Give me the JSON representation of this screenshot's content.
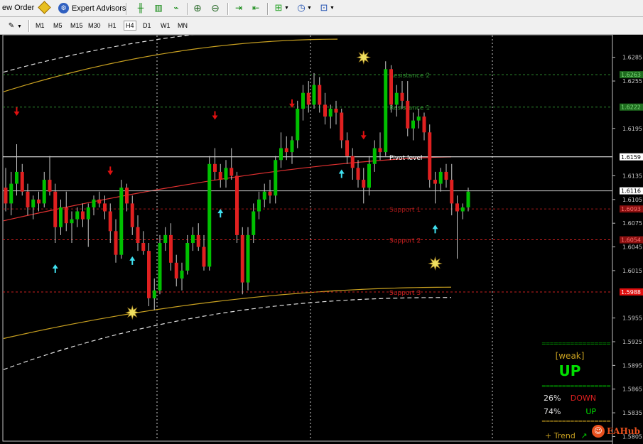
{
  "toolbar": {
    "new_order": "ew Order",
    "expert_advisors": "Expert Advisors"
  },
  "timeframes": [
    "M1",
    "M5",
    "M15",
    "M30",
    "H1",
    "H4",
    "D1",
    "W1",
    "MN"
  ],
  "selected_timeframe": "H4",
  "price_scale": [
    {
      "price": 1.6285,
      "text": "1.6285"
    },
    {
      "price": 1.6255,
      "text": "1.6255"
    },
    {
      "price": 1.6195,
      "text": "1.6195"
    },
    {
      "price": 1.6135,
      "text": "1.6135"
    },
    {
      "price": 1.6105,
      "text": "1.6105"
    },
    {
      "price": 1.6075,
      "text": "1.6075"
    },
    {
      "price": 1.6045,
      "text": "1.6045"
    },
    {
      "price": 1.6015,
      "text": "1.6015"
    },
    {
      "price": 1.5955,
      "text": "1.5955"
    },
    {
      "price": 1.5925,
      "text": "1.5925"
    },
    {
      "price": 1.5895,
      "text": "1.5895"
    },
    {
      "price": 1.5865,
      "text": "1.5865"
    },
    {
      "price": 1.5835,
      "text": "1.5835"
    },
    {
      "price": 1.5805,
      "text": "1.5805"
    }
  ],
  "price_tags": [
    {
      "price": 1.6263,
      "text": "1.6263",
      "bg": "#1f6e1f",
      "fg": "#7ddc7d"
    },
    {
      "price": 1.6222,
      "text": "1.6222",
      "bg": "#1f6e1f",
      "fg": "#7ddc7d"
    },
    {
      "price": 1.6159,
      "text": "1.6159",
      "bg": "#ffffff",
      "fg": "#000000"
    },
    {
      "price": 1.6116,
      "text": "1.6116",
      "bg": "#ffffff",
      "fg": "#000000"
    },
    {
      "price": 1.6093,
      "text": "1.6093",
      "bg": "#8a1010",
      "fg": "#ff7070"
    },
    {
      "price": 1.6054,
      "text": "1.6054",
      "bg": "#8a1010",
      "fg": "#ff7070"
    },
    {
      "price": 1.5988,
      "text": "1.5988",
      "bg": "#e01010",
      "fg": "#ffffff"
    }
  ],
  "levels": [
    {
      "price": 1.6263,
      "label": "Resistance 2",
      "color": "#2e8b2e",
      "style": "dash"
    },
    {
      "price": 1.6222,
      "label": "Resistance 1",
      "color": "#2e8b2e",
      "style": "dash"
    },
    {
      "price": 1.6159,
      "label": "Pivot level",
      "color": "#ffffff",
      "style": "solid"
    },
    {
      "price": 1.6116,
      "label": "",
      "color": "#c8c8c8",
      "style": "solid"
    },
    {
      "price": 1.6093,
      "label": "Support 1",
      "color": "#a01818",
      "style": "dash"
    },
    {
      "price": 1.6054,
      "label": "Support 2",
      "color": "#c82020",
      "style": "dash"
    },
    {
      "price": 1.5988,
      "label": "Support 3",
      "color": "#c82020",
      "style": "dash"
    }
  ],
  "candles": [
    {
      "o": 1.612,
      "h": 1.6145,
      "l": 1.609,
      "c": 1.61
    },
    {
      "o": 1.61,
      "h": 1.614,
      "l": 1.6085,
      "c": 1.6125
    },
    {
      "o": 1.6125,
      "h": 1.6175,
      "l": 1.611,
      "c": 1.614
    },
    {
      "o": 1.614,
      "h": 1.615,
      "l": 1.611,
      "c": 1.6115
    },
    {
      "o": 1.6115,
      "h": 1.6125,
      "l": 1.6085,
      "c": 1.6095
    },
    {
      "o": 1.6095,
      "h": 1.611,
      "l": 1.608,
      "c": 1.6105
    },
    {
      "o": 1.6105,
      "h": 1.6115,
      "l": 1.609,
      "c": 1.61
    },
    {
      "o": 1.61,
      "h": 1.614,
      "l": 1.6095,
      "c": 1.613
    },
    {
      "o": 1.613,
      "h": 1.616,
      "l": 1.611,
      "c": 1.6115
    },
    {
      "o": 1.6115,
      "h": 1.6125,
      "l": 1.605,
      "c": 1.607
    },
    {
      "o": 1.607,
      "h": 1.6105,
      "l": 1.606,
      "c": 1.6095
    },
    {
      "o": 1.6095,
      "h": 1.6115,
      "l": 1.6065,
      "c": 1.6075
    },
    {
      "o": 1.6075,
      "h": 1.609,
      "l": 1.605,
      "c": 1.608
    },
    {
      "o": 1.608,
      "h": 1.6095,
      "l": 1.607,
      "c": 1.609
    },
    {
      "o": 1.609,
      "h": 1.61,
      "l": 1.607,
      "c": 1.608
    },
    {
      "o": 1.608,
      "h": 1.61,
      "l": 1.6045,
      "c": 1.6095
    },
    {
      "o": 1.6095,
      "h": 1.611,
      "l": 1.6085,
      "c": 1.6105
    },
    {
      "o": 1.6105,
      "h": 1.6115,
      "l": 1.6095,
      "c": 1.61
    },
    {
      "o": 1.61,
      "h": 1.611,
      "l": 1.608,
      "c": 1.609
    },
    {
      "o": 1.609,
      "h": 1.61,
      "l": 1.605,
      "c": 1.6065
    },
    {
      "o": 1.6065,
      "h": 1.608,
      "l": 1.6025,
      "c": 1.6035
    },
    {
      "o": 1.6035,
      "h": 1.613,
      "l": 1.603,
      "c": 1.612
    },
    {
      "o": 1.612,
      "h": 1.6125,
      "l": 1.609,
      "c": 1.61
    },
    {
      "o": 1.61,
      "h": 1.611,
      "l": 1.606,
      "c": 1.607
    },
    {
      "o": 1.607,
      "h": 1.6085,
      "l": 1.604,
      "c": 1.605
    },
    {
      "o": 1.605,
      "h": 1.6065,
      "l": 1.6035,
      "c": 1.604
    },
    {
      "o": 1.604,
      "h": 1.605,
      "l": 1.597,
      "c": 1.598
    },
    {
      "o": 1.598,
      "h": 1.6005,
      "l": 1.5965,
      "c": 1.599
    },
    {
      "o": 1.599,
      "h": 1.606,
      "l": 1.5985,
      "c": 1.605
    },
    {
      "o": 1.605,
      "h": 1.607,
      "l": 1.604,
      "c": 1.606
    },
    {
      "o": 1.606,
      "h": 1.6075,
      "l": 1.6015,
      "c": 1.6025
    },
    {
      "o": 1.6025,
      "h": 1.6035,
      "l": 1.5995,
      "c": 1.6005
    },
    {
      "o": 1.6005,
      "h": 1.6025,
      "l": 1.599,
      "c": 1.6015
    },
    {
      "o": 1.6015,
      "h": 1.606,
      "l": 1.601,
      "c": 1.605
    },
    {
      "o": 1.605,
      "h": 1.607,
      "l": 1.604,
      "c": 1.606
    },
    {
      "o": 1.606,
      "h": 1.6075,
      "l": 1.604,
      "c": 1.6045
    },
    {
      "o": 1.6045,
      "h": 1.606,
      "l": 1.6015,
      "c": 1.602
    },
    {
      "o": 1.602,
      "h": 1.616,
      "l": 1.6015,
      "c": 1.615
    },
    {
      "o": 1.615,
      "h": 1.617,
      "l": 1.613,
      "c": 1.614
    },
    {
      "o": 1.614,
      "h": 1.615,
      "l": 1.612,
      "c": 1.613
    },
    {
      "o": 1.613,
      "h": 1.6155,
      "l": 1.612,
      "c": 1.6145
    },
    {
      "o": 1.6145,
      "h": 1.617,
      "l": 1.613,
      "c": 1.6135
    },
    {
      "o": 1.6135,
      "h": 1.614,
      "l": 1.605,
      "c": 1.606
    },
    {
      "o": 1.606,
      "h": 1.607,
      "l": 1.5985,
      "c": 1.6
    },
    {
      "o": 1.6,
      "h": 1.607,
      "l": 1.599,
      "c": 1.606
    },
    {
      "o": 1.606,
      "h": 1.61,
      "l": 1.605,
      "c": 1.609
    },
    {
      "o": 1.609,
      "h": 1.6115,
      "l": 1.608,
      "c": 1.6105
    },
    {
      "o": 1.6105,
      "h": 1.6125,
      "l": 1.6095,
      "c": 1.6115
    },
    {
      "o": 1.6115,
      "h": 1.613,
      "l": 1.61,
      "c": 1.611
    },
    {
      "o": 1.611,
      "h": 1.616,
      "l": 1.61,
      "c": 1.6155
    },
    {
      "o": 1.6155,
      "h": 1.619,
      "l": 1.6145,
      "c": 1.617
    },
    {
      "o": 1.617,
      "h": 1.6185,
      "l": 1.6155,
      "c": 1.6165
    },
    {
      "o": 1.6165,
      "h": 1.6185,
      "l": 1.615,
      "c": 1.618
    },
    {
      "o": 1.618,
      "h": 1.623,
      "l": 1.617,
      "c": 1.622
    },
    {
      "o": 1.622,
      "h": 1.625,
      "l": 1.6205,
      "c": 1.624
    },
    {
      "o": 1.624,
      "h": 1.6255,
      "l": 1.6215,
      "c": 1.6225
    },
    {
      "o": 1.6225,
      "h": 1.6265,
      "l": 1.622,
      "c": 1.625
    },
    {
      "o": 1.625,
      "h": 1.626,
      "l": 1.6215,
      "c": 1.6225
    },
    {
      "o": 1.6225,
      "h": 1.624,
      "l": 1.62,
      "c": 1.621
    },
    {
      "o": 1.621,
      "h": 1.6225,
      "l": 1.6195,
      "c": 1.622
    },
    {
      "o": 1.622,
      "h": 1.623,
      "l": 1.62,
      "c": 1.6215
    },
    {
      "o": 1.6215,
      "h": 1.622,
      "l": 1.617,
      "c": 1.618
    },
    {
      "o": 1.618,
      "h": 1.619,
      "l": 1.615,
      "c": 1.616
    },
    {
      "o": 1.616,
      "h": 1.617,
      "l": 1.613,
      "c": 1.6145
    },
    {
      "o": 1.6145,
      "h": 1.6155,
      "l": 1.612,
      "c": 1.613
    },
    {
      "o": 1.613,
      "h": 1.6145,
      "l": 1.61,
      "c": 1.612
    },
    {
      "o": 1.612,
      "h": 1.616,
      "l": 1.611,
      "c": 1.615
    },
    {
      "o": 1.615,
      "h": 1.618,
      "l": 1.614,
      "c": 1.617
    },
    {
      "o": 1.617,
      "h": 1.619,
      "l": 1.6155,
      "c": 1.6165
    },
    {
      "o": 1.6165,
      "h": 1.628,
      "l": 1.616,
      "c": 1.627
    },
    {
      "o": 1.627,
      "h": 1.6275,
      "l": 1.6215,
      "c": 1.6225
    },
    {
      "o": 1.6225,
      "h": 1.625,
      "l": 1.621,
      "c": 1.624
    },
    {
      "o": 1.624,
      "h": 1.6255,
      "l": 1.622,
      "c": 1.623
    },
    {
      "o": 1.623,
      "h": 1.6255,
      "l": 1.6185,
      "c": 1.6195
    },
    {
      "o": 1.6195,
      "h": 1.6215,
      "l": 1.618,
      "c": 1.6205
    },
    {
      "o": 1.6205,
      "h": 1.622,
      "l": 1.6195,
      "c": 1.621
    },
    {
      "o": 1.621,
      "h": 1.6215,
      "l": 1.618,
      "c": 1.619
    },
    {
      "o": 1.619,
      "h": 1.62,
      "l": 1.612,
      "c": 1.613
    },
    {
      "o": 1.613,
      "h": 1.614,
      "l": 1.61,
      "c": 1.6125
    },
    {
      "o": 1.6125,
      "h": 1.6145,
      "l": 1.6115,
      "c": 1.614
    },
    {
      "o": 1.614,
      "h": 1.615,
      "l": 1.612,
      "c": 1.613
    },
    {
      "o": 1.613,
      "h": 1.615,
      "l": 1.6085,
      "c": 1.61
    },
    {
      "o": 1.61,
      "h": 1.611,
      "l": 1.603,
      "c": 1.609
    },
    {
      "o": 1.609,
      "h": 1.61,
      "l": 1.608,
      "c": 1.6095
    },
    {
      "o": 1.6095,
      "h": 1.612,
      "l": 1.609,
      "c": 1.6115
    }
  ],
  "signals": {
    "down_arrows": [
      2,
      19,
      38,
      52,
      65
    ],
    "up_arrows": [
      9,
      23,
      39,
      61,
      78
    ],
    "stars": [
      {
        "index": 23,
        "price": 1.5962
      },
      {
        "index": 65,
        "price": 1.6285
      },
      {
        "index": 78,
        "price": 1.6024
      }
    ]
  },
  "info_box": {
    "dashes": "=================",
    "strength": "[weak]",
    "direction": "UP",
    "down_pct": "26%",
    "down_label": "DOWN",
    "up_pct": "74%",
    "up_label": "UP",
    "trend_label": "+  Trend",
    "trend_icon": "↗"
  },
  "watermark": {
    "text": "EAHub"
  },
  "colors": {
    "bull": "#00c000",
    "bear": "#e02020",
    "up_arrow": "#40e0f0",
    "down_arrow": "#e01010",
    "star": "#f0e060"
  }
}
